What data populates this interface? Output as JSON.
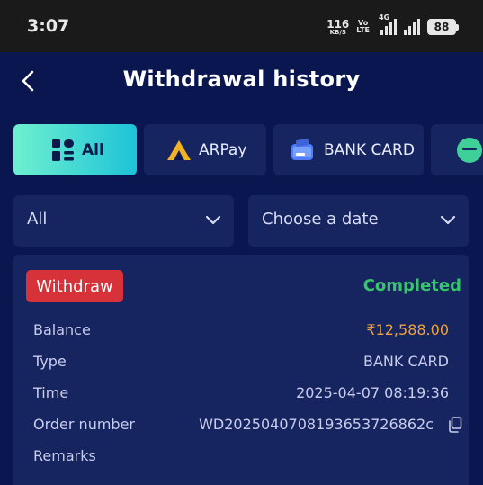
{
  "status_bar": {
    "time": "3:07",
    "net_speed_value": "116",
    "net_speed_unit": "KB/S",
    "volte_top": "Vo",
    "volte_bottom": "LTE",
    "network_type": "4G",
    "battery": "88"
  },
  "header": {
    "title": "Withdrawal history",
    "back_icon": "chevron-left-icon"
  },
  "tabs": [
    {
      "label": "All",
      "icon": "grid-icon",
      "active": true
    },
    {
      "label": "ARPay",
      "icon": "arpay-logo-icon",
      "active": false
    },
    {
      "label": "BANK CARD",
      "icon": "bank-card-icon",
      "active": false
    },
    {
      "label": "",
      "icon": "partial-tab-icon",
      "active": false
    }
  ],
  "filters": {
    "type_value": "All",
    "date_placeholder": "Choose a date"
  },
  "record": {
    "badge": "Withdraw",
    "status": "Completed",
    "rows": [
      {
        "label": "Balance",
        "value": "₹12,588.00"
      },
      {
        "label": "Type",
        "value": "BANK CARD"
      },
      {
        "label": "Time",
        "value": "2025-04-07 08:19:36"
      },
      {
        "label": "Order number",
        "value": "WD2025040708193653726862c"
      },
      {
        "label": "Remarks",
        "value": ""
      }
    ]
  },
  "colors": {
    "background": "#0a1650",
    "panel": "#16245f",
    "accent_gradient_start": "#6ef0cf",
    "accent_gradient_end": "#1dc3d8",
    "withdraw_badge": "#d7323a",
    "completed": "#38c46c",
    "balance": "#f0a23a"
  }
}
